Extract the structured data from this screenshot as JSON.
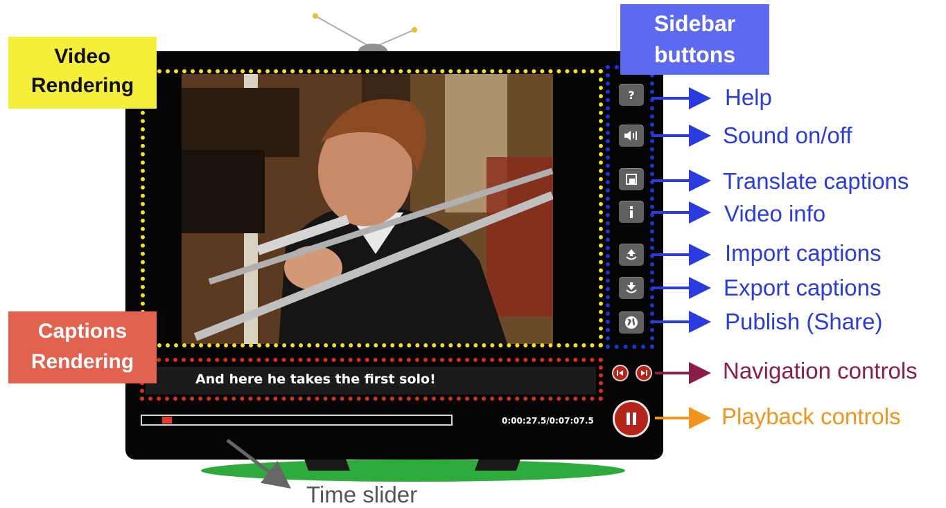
{
  "labels": {
    "video_rendering": [
      "Video",
      "Rendering"
    ],
    "sidebar_buttons": [
      "Sidebar",
      "buttons"
    ],
    "captions_rendering": [
      "Captions",
      "Rendering"
    ]
  },
  "player": {
    "caption": "And here he takes the first solo!",
    "timecode": "0:00:27.5/0:07:07.5",
    "progress_fraction": 0.064
  },
  "sidebar": [
    {
      "icon": "help-icon",
      "label": "Help"
    },
    {
      "icon": "sound-icon",
      "label": "Sound on/off"
    },
    {
      "icon": "translate-icon",
      "label": "Translate captions"
    },
    {
      "icon": "info-icon",
      "label": "Video info"
    },
    {
      "icon": "import-icon",
      "label": "Import captions"
    },
    {
      "icon": "export-icon",
      "label": "Export captions"
    },
    {
      "icon": "globe-icon",
      "label": "Publish (Share)"
    }
  ],
  "annotations": {
    "navigation_controls": "Navigation controls",
    "playback_controls": "Playback controls",
    "time_slider": "Time slider"
  },
  "colors": {
    "sidebar_annotation": "#2a3ce0",
    "navigation_annotation": "#8a1e4a",
    "playback_annotation": "#f0961e",
    "time_slider_annotation": "#555555",
    "video_frame": "#f5e21e",
    "sidebar_frame": "#1a35d8",
    "captions_frame": "#d8301c"
  }
}
